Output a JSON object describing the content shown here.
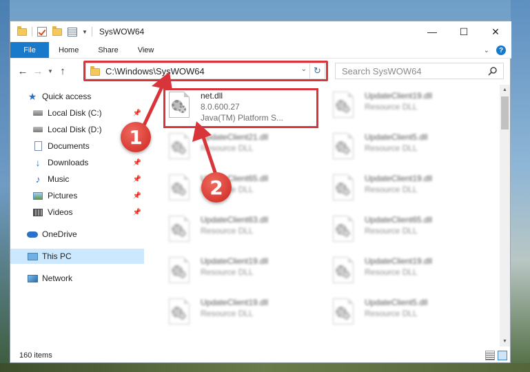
{
  "window": {
    "title": "SysWOW64",
    "controls": {
      "minimize": "—",
      "maximize": "☐",
      "close": "✕"
    }
  },
  "ribbon": {
    "tabs": [
      {
        "label": "File"
      },
      {
        "label": "Home"
      },
      {
        "label": "Share"
      },
      {
        "label": "View"
      }
    ],
    "help": "?"
  },
  "navbar": {
    "address": "C:\\Windows\\SysWOW64",
    "search_placeholder": "Search SysWOW64"
  },
  "sidebar": {
    "items": [
      {
        "label": "Quick access"
      },
      {
        "label": "Local Disk (C:)"
      },
      {
        "label": "Local Disk (D:)"
      },
      {
        "label": "Documents"
      },
      {
        "label": "Downloads"
      },
      {
        "label": "Music"
      },
      {
        "label": "Pictures"
      },
      {
        "label": "Videos"
      },
      {
        "label": "OneDrive"
      },
      {
        "label": "This PC"
      },
      {
        "label": "Network"
      }
    ]
  },
  "files": [
    {
      "name": "net.dll",
      "line1": "8.0.600.27",
      "line2": "Java(TM) Platform S..."
    },
    {
      "name": "UpdateClient19.dll",
      "line1": "Resource DLL",
      "line2": ""
    },
    {
      "name": "UpdateClient21.dll",
      "line1": "Resource DLL",
      "line2": ""
    },
    {
      "name": "UpdateClient5.dll",
      "line1": "Resource DLL",
      "line2": ""
    },
    {
      "name": "UpdateClient65.dll",
      "line1": "Resource DLL",
      "line2": ""
    },
    {
      "name": "UpdateClient19.dll",
      "line1": "Resource DLL",
      "line2": ""
    },
    {
      "name": "UpdateClient63.dll",
      "line1": "Resource DLL",
      "line2": ""
    },
    {
      "name": "UpdateClient65.dll",
      "line1": "Resource DLL",
      "line2": ""
    },
    {
      "name": "UpdateClient19.dll",
      "line1": "Resource DLL",
      "line2": ""
    },
    {
      "name": "UpdateClient19.dll",
      "line1": "Resource DLL",
      "line2": ""
    },
    {
      "name": "UpdateClient19.dll",
      "line1": "Resource DLL",
      "line2": ""
    },
    {
      "name": "UpdateClient5.dll",
      "line1": "Resource DLL",
      "line2": ""
    }
  ],
  "status": {
    "item_count": "160 items"
  },
  "callouts": [
    {
      "number": "1"
    },
    {
      "number": "2"
    }
  ],
  "colors": {
    "accent": "#1979ca",
    "highlight": "#d9343a",
    "selected": "#cce8ff"
  }
}
